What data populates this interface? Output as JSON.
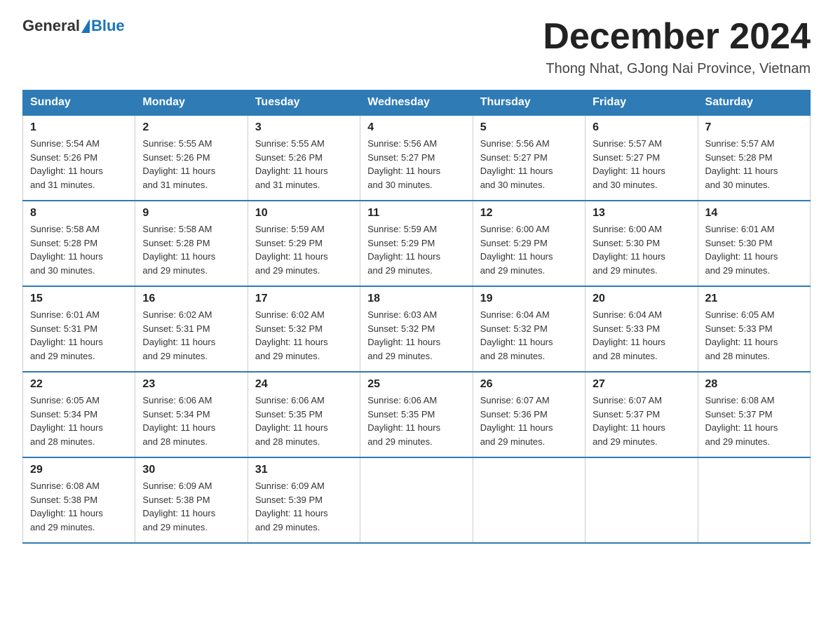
{
  "header": {
    "logo_general": "General",
    "logo_blue": "Blue",
    "title": "December 2024",
    "subtitle": "Thong Nhat, GJong Nai Province, Vietnam"
  },
  "columns": [
    "Sunday",
    "Monday",
    "Tuesday",
    "Wednesday",
    "Thursday",
    "Friday",
    "Saturday"
  ],
  "weeks": [
    [
      {
        "day": "1",
        "info": "Sunrise: 5:54 AM\nSunset: 5:26 PM\nDaylight: 11 hours\nand 31 minutes."
      },
      {
        "day": "2",
        "info": "Sunrise: 5:55 AM\nSunset: 5:26 PM\nDaylight: 11 hours\nand 31 minutes."
      },
      {
        "day": "3",
        "info": "Sunrise: 5:55 AM\nSunset: 5:26 PM\nDaylight: 11 hours\nand 31 minutes."
      },
      {
        "day": "4",
        "info": "Sunrise: 5:56 AM\nSunset: 5:27 PM\nDaylight: 11 hours\nand 30 minutes."
      },
      {
        "day": "5",
        "info": "Sunrise: 5:56 AM\nSunset: 5:27 PM\nDaylight: 11 hours\nand 30 minutes."
      },
      {
        "day": "6",
        "info": "Sunrise: 5:57 AM\nSunset: 5:27 PM\nDaylight: 11 hours\nand 30 minutes."
      },
      {
        "day": "7",
        "info": "Sunrise: 5:57 AM\nSunset: 5:28 PM\nDaylight: 11 hours\nand 30 minutes."
      }
    ],
    [
      {
        "day": "8",
        "info": "Sunrise: 5:58 AM\nSunset: 5:28 PM\nDaylight: 11 hours\nand 30 minutes."
      },
      {
        "day": "9",
        "info": "Sunrise: 5:58 AM\nSunset: 5:28 PM\nDaylight: 11 hours\nand 29 minutes."
      },
      {
        "day": "10",
        "info": "Sunrise: 5:59 AM\nSunset: 5:29 PM\nDaylight: 11 hours\nand 29 minutes."
      },
      {
        "day": "11",
        "info": "Sunrise: 5:59 AM\nSunset: 5:29 PM\nDaylight: 11 hours\nand 29 minutes."
      },
      {
        "day": "12",
        "info": "Sunrise: 6:00 AM\nSunset: 5:29 PM\nDaylight: 11 hours\nand 29 minutes."
      },
      {
        "day": "13",
        "info": "Sunrise: 6:00 AM\nSunset: 5:30 PM\nDaylight: 11 hours\nand 29 minutes."
      },
      {
        "day": "14",
        "info": "Sunrise: 6:01 AM\nSunset: 5:30 PM\nDaylight: 11 hours\nand 29 minutes."
      }
    ],
    [
      {
        "day": "15",
        "info": "Sunrise: 6:01 AM\nSunset: 5:31 PM\nDaylight: 11 hours\nand 29 minutes."
      },
      {
        "day": "16",
        "info": "Sunrise: 6:02 AM\nSunset: 5:31 PM\nDaylight: 11 hours\nand 29 minutes."
      },
      {
        "day": "17",
        "info": "Sunrise: 6:02 AM\nSunset: 5:32 PM\nDaylight: 11 hours\nand 29 minutes."
      },
      {
        "day": "18",
        "info": "Sunrise: 6:03 AM\nSunset: 5:32 PM\nDaylight: 11 hours\nand 29 minutes."
      },
      {
        "day": "19",
        "info": "Sunrise: 6:04 AM\nSunset: 5:32 PM\nDaylight: 11 hours\nand 28 minutes."
      },
      {
        "day": "20",
        "info": "Sunrise: 6:04 AM\nSunset: 5:33 PM\nDaylight: 11 hours\nand 28 minutes."
      },
      {
        "day": "21",
        "info": "Sunrise: 6:05 AM\nSunset: 5:33 PM\nDaylight: 11 hours\nand 28 minutes."
      }
    ],
    [
      {
        "day": "22",
        "info": "Sunrise: 6:05 AM\nSunset: 5:34 PM\nDaylight: 11 hours\nand 28 minutes."
      },
      {
        "day": "23",
        "info": "Sunrise: 6:06 AM\nSunset: 5:34 PM\nDaylight: 11 hours\nand 28 minutes."
      },
      {
        "day": "24",
        "info": "Sunrise: 6:06 AM\nSunset: 5:35 PM\nDaylight: 11 hours\nand 28 minutes."
      },
      {
        "day": "25",
        "info": "Sunrise: 6:06 AM\nSunset: 5:35 PM\nDaylight: 11 hours\nand 29 minutes."
      },
      {
        "day": "26",
        "info": "Sunrise: 6:07 AM\nSunset: 5:36 PM\nDaylight: 11 hours\nand 29 minutes."
      },
      {
        "day": "27",
        "info": "Sunrise: 6:07 AM\nSunset: 5:37 PM\nDaylight: 11 hours\nand 29 minutes."
      },
      {
        "day": "28",
        "info": "Sunrise: 6:08 AM\nSunset: 5:37 PM\nDaylight: 11 hours\nand 29 minutes."
      }
    ],
    [
      {
        "day": "29",
        "info": "Sunrise: 6:08 AM\nSunset: 5:38 PM\nDaylight: 11 hours\nand 29 minutes."
      },
      {
        "day": "30",
        "info": "Sunrise: 6:09 AM\nSunset: 5:38 PM\nDaylight: 11 hours\nand 29 minutes."
      },
      {
        "day": "31",
        "info": "Sunrise: 6:09 AM\nSunset: 5:39 PM\nDaylight: 11 hours\nand 29 minutes."
      },
      null,
      null,
      null,
      null
    ]
  ]
}
